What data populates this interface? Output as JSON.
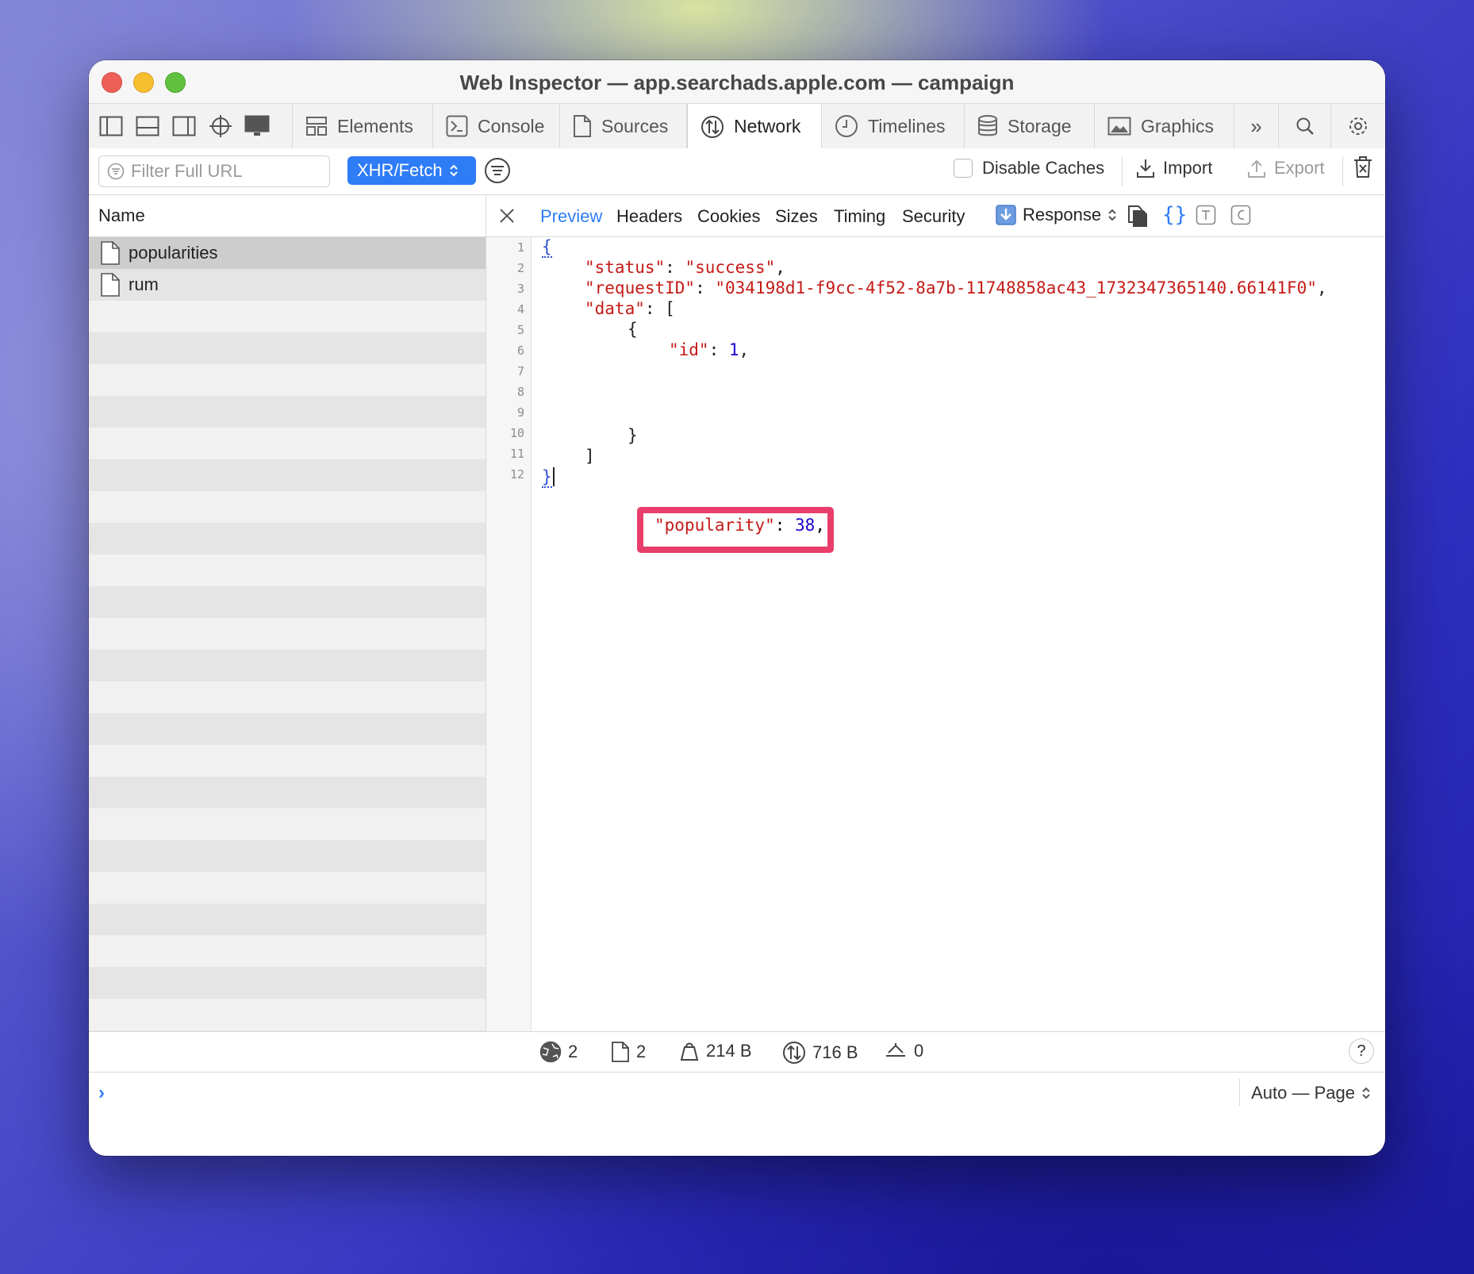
{
  "window": {
    "title": "Web Inspector — app.searchads.apple.com — campaign"
  },
  "toolbar": {
    "layout_icons": [
      "dock-left-icon",
      "dock-bottom-icon",
      "dock-right-icon",
      "crosshair-icon",
      "device-icon"
    ],
    "tabs": [
      {
        "label": "Elements",
        "icon": "elements-icon"
      },
      {
        "label": "Console",
        "icon": "console-icon"
      },
      {
        "label": "Sources",
        "icon": "document-icon"
      },
      {
        "label": "Network",
        "icon": "network-icon",
        "active": true
      },
      {
        "label": "Timelines",
        "icon": "clock-icon"
      },
      {
        "label": "Storage",
        "icon": "database-icon"
      },
      {
        "label": "Graphics",
        "icon": "image-icon"
      }
    ],
    "overflow": "»"
  },
  "filterbar": {
    "filter_placeholder": "Filter Full URL",
    "type_filter": "XHR/Fetch",
    "disable_caches": "Disable Caches",
    "disable_caches_checked": false,
    "import": "Import",
    "export": "Export"
  },
  "request_list": {
    "header": "Name",
    "items": [
      {
        "name": "popularities",
        "selected": true
      },
      {
        "name": "rum"
      }
    ]
  },
  "detail": {
    "tabs": [
      "Preview",
      "Headers",
      "Cookies",
      "Sizes",
      "Timing",
      "Security"
    ],
    "active_tab": "Preview",
    "response_mode": "Response"
  },
  "code": {
    "line_numbers": [
      "1",
      "2",
      "3",
      "4",
      "5",
      "6",
      "7",
      "8",
      "9",
      "10",
      "11",
      "12"
    ],
    "status_key": "\"status\"",
    "status_value": "\"success\"",
    "request_id_key": "\"requestID\"",
    "request_id_value": "\"034198d1-f9cc-4f52-8a7b-11748858ac43_1732347365140.66141F0\"",
    "data_key": "\"data\"",
    "id_key": "\"id\"",
    "id_value": "1",
    "popularity_key": "\"popularity\"",
    "popularity_value": "38"
  },
  "status": {
    "requests": "2",
    "resources": "2",
    "transferred": "214 B",
    "size": "716 B",
    "redirects": "0",
    "help": "?"
  },
  "console": {
    "prompt": "›",
    "context": "Auto — Page"
  },
  "colors": {
    "accent": "#2e7cf6",
    "highlight_box": "#e73e6a",
    "json_string": "#c41a16",
    "json_number": "#1c00cf"
  }
}
